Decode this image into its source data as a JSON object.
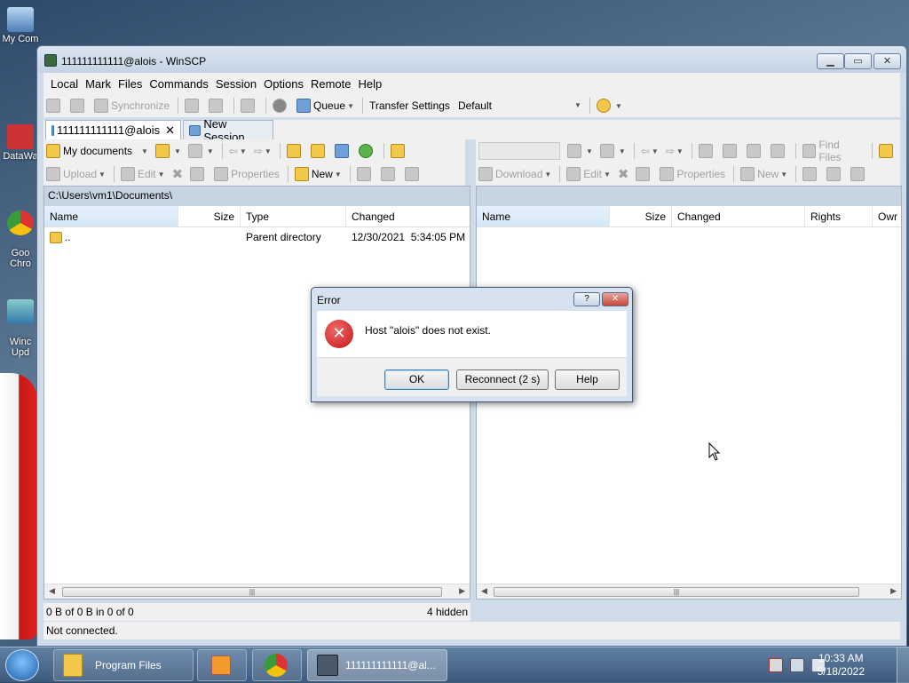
{
  "desktop": {
    "icons": [
      {
        "label": "My Com"
      },
      {
        "label": "DataWa"
      },
      {
        "label": "Goo\nChro"
      },
      {
        "label": "Winc\nUpd"
      }
    ]
  },
  "window": {
    "title": "111111111111@alois - WinSCP",
    "menu": [
      "Local",
      "Mark",
      "Files",
      "Commands",
      "Session",
      "Options",
      "Remote",
      "Help"
    ],
    "toolbar1": {
      "synchronize": "Synchronize",
      "queue": "Queue",
      "transfer_settings_label": "Transfer Settings",
      "transfer_settings_value": "Default"
    },
    "tabs": [
      {
        "label": "111111111111@alois"
      },
      {
        "label": "New Session"
      }
    ],
    "local": {
      "location": "My documents",
      "toolbar": {
        "upload": "Upload",
        "edit": "Edit",
        "properties": "Properties",
        "new": "New"
      },
      "path": "C:\\Users\\vm1\\Documents\\",
      "columns": [
        "Name",
        "Size",
        "Type",
        "Changed"
      ],
      "rows": [
        {
          "name": "..",
          "size": "",
          "type": "Parent directory",
          "changed": "12/30/2021  5:34:05 PM"
        }
      ]
    },
    "remote": {
      "toolbar": {
        "find_files": "Find Files",
        "download": "Download",
        "edit": "Edit",
        "properties": "Properties",
        "new": "New"
      },
      "columns": [
        "Name",
        "Size",
        "Changed",
        "Rights",
        "Owr"
      ]
    },
    "status": {
      "local_summary": "0 B of 0 B in 0 of 0",
      "hidden": "4 hidden",
      "connection": "Not connected."
    }
  },
  "dialog": {
    "title": "Error",
    "message": "Host \"alois\" does not exist.",
    "buttons": {
      "ok": "OK",
      "reconnect": "Reconnect (2 s)",
      "help": "Help"
    },
    "help_glyph": "?"
  },
  "taskbar": {
    "items": [
      {
        "label": "Program Files"
      },
      {
        "label": "111111111111@al..."
      }
    ],
    "time": "10:33 AM",
    "date": "5/18/2022"
  }
}
